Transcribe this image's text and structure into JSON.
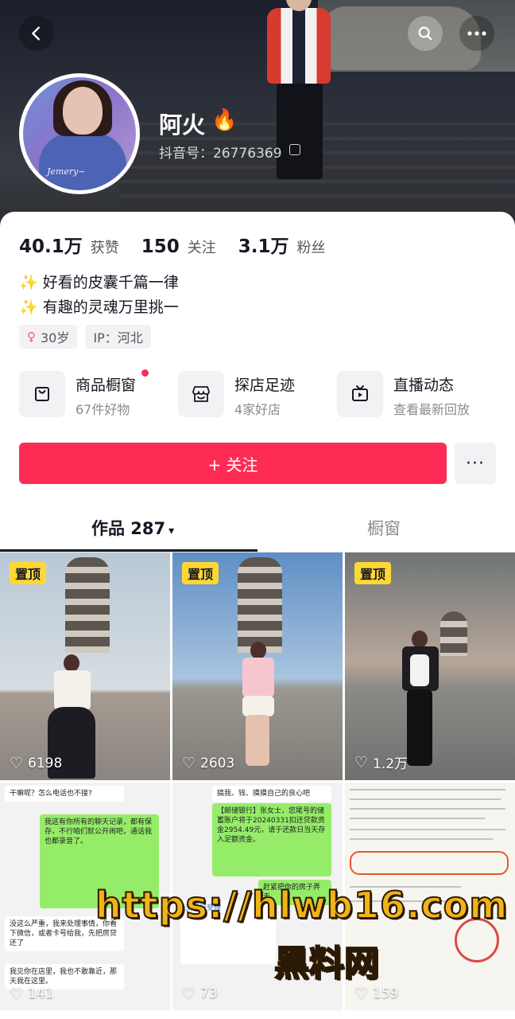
{
  "header": {
    "name": "阿火",
    "name_emoji": "🔥",
    "douyin_id": "抖音号：26776369",
    "icons": {
      "back": "back-arrow-icon",
      "search": "search-icon",
      "more": "more-dots-icon",
      "copy": "copy-icon"
    }
  },
  "stats": [
    {
      "value": "40.1万",
      "label": "获赞"
    },
    {
      "value": "150",
      "label": "关注"
    },
    {
      "value": "3.1万",
      "label": "粉丝"
    }
  ],
  "bio": [
    "✨ 好看的皮囊千篇一律",
    "✨ 有趣的灵魂万里挑一"
  ],
  "tags": {
    "age_symbol": "♀",
    "age": "30岁",
    "ip": "IP：河北"
  },
  "features": [
    {
      "title": "商品橱窗",
      "sub": "67件好物",
      "icon": "shopping-bag-icon"
    },
    {
      "title": "探店足迹",
      "sub": "4家好店",
      "icon": "store-icon"
    },
    {
      "title": "直播动态",
      "sub": "查看最新回放",
      "icon": "live-tv-icon"
    }
  ],
  "follow": {
    "label": "+ 关注",
    "more": "···"
  },
  "tabs": {
    "works": "作品 287",
    "caret": "▾",
    "shop": "橱窗"
  },
  "grid": [
    {
      "pin": "置顶",
      "likes": "6198"
    },
    {
      "pin": "置顶",
      "likes": "2603"
    },
    {
      "pin": "置顶",
      "likes": "1.2万"
    },
    {
      "likes": "141"
    },
    {
      "likes": "73"
    },
    {
      "likes": "159"
    }
  ],
  "chat_snippets": {
    "c1_top": "干嘛呢？怎么电话也不接?",
    "c1_green": "我这有你所有的聊天记录，都有保存，不行咱们就公开闹吧，通话我也都录音了。",
    "c1_mid": "没这么严重，我来处理事情，你看下微信，或者卡号给我，先把房贷还了",
    "c1_low": "我见你在店里，我也不敢靠近，那天我在这里。",
    "c2_top": "搞我、钱、摸摸自己的良心吧",
    "c2_green": "【邮储银行】张女士，您尾号的储蓄账户将于20240331扣还贷款资金2954.49元，请于还款日当天存入足额资金。",
    "c2_green2": "赶紧把你的房子弄走",
    "c2_card": "交易已受理"
  },
  "watermark": {
    "url": "https://hlwb16.com",
    "cn": "黑料网"
  },
  "colors": {
    "accent": "#fe2c55",
    "pin": "#fdd835",
    "text": "#161823",
    "muted": "#8a8b91"
  }
}
